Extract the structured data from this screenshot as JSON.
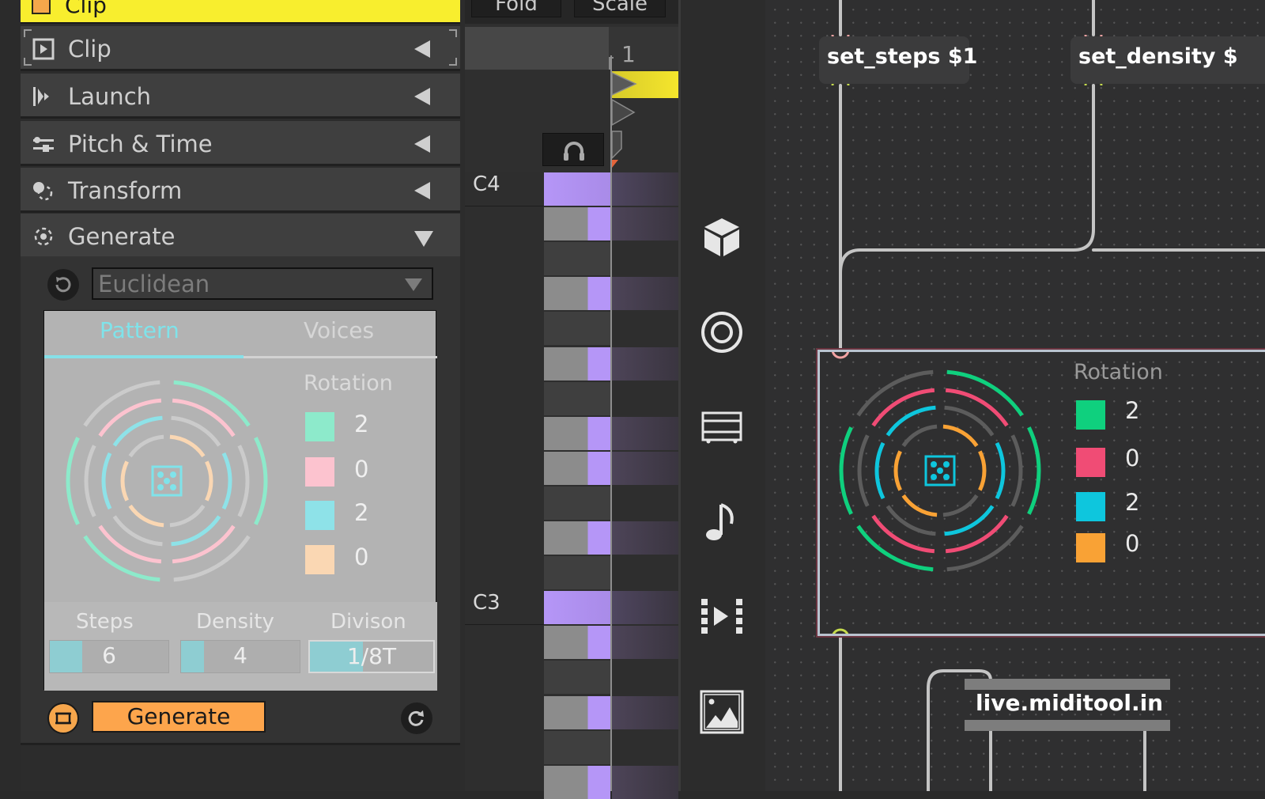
{
  "inspector": {
    "clip_header_label": "Clip",
    "sections": [
      {
        "label": "Clip",
        "icon": "clip-play-icon",
        "state": "collapsed"
      },
      {
        "label": "Launch",
        "icon": "launch-icon",
        "state": "collapsed"
      },
      {
        "label": "Pitch & Time",
        "icon": "sliders-icon",
        "state": "collapsed"
      },
      {
        "label": "Transform",
        "icon": "transform-icon",
        "state": "collapsed"
      },
      {
        "label": "Generate",
        "icon": "generate-icon",
        "state": "expanded"
      }
    ],
    "generate": {
      "algorithm": "Euclidean",
      "tabs": [
        "Pattern",
        "Voices"
      ],
      "active_tab": "Pattern",
      "rotation_title": "Rotation",
      "voices": [
        {
          "color": "#8deacb",
          "rotation": "2"
        },
        {
          "color": "#fcc3cf",
          "rotation": "0"
        },
        {
          "color": "#8ee2e8",
          "rotation": "2"
        },
        {
          "color": "#fad7b3",
          "rotation": "0"
        }
      ],
      "params": [
        {
          "label": "Steps",
          "value": "6",
          "fill": 0.27
        },
        {
          "label": "Density",
          "value": "4",
          "fill": 0.19
        },
        {
          "label": "Divison",
          "value": "1/8T",
          "fill": 0.43
        }
      ],
      "generate_label": "Generate"
    }
  },
  "piano_roll": {
    "buttons": [
      "Fold",
      "Scale"
    ],
    "bar_number": "1",
    "note_labels": {
      "c4": "C4",
      "c3": "C3"
    },
    "note_color": "#b596f7"
  },
  "sidebar_icons": [
    "package-icon",
    "target-icon",
    "clip-icon",
    "note-icon",
    "sample-icon",
    "image-icon"
  ],
  "patcher": {
    "objects": {
      "set_steps": "set_steps $1",
      "set_density": "set_density $",
      "miditool": "live.miditool.in"
    },
    "rotation_title": "Rotation",
    "voices": [
      {
        "color": "#0fd07e",
        "rotation": "2"
      },
      {
        "color": "#f04c75",
        "rotation": "0"
      },
      {
        "color": "#0ec6dd",
        "rotation": "2"
      },
      {
        "color": "#f9a235",
        "rotation": "0"
      }
    ]
  }
}
